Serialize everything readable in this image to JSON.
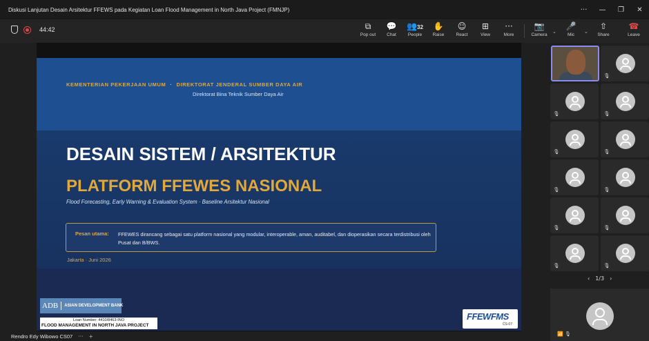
{
  "window": {
    "title": "Diskusi Lanjutan Desain Arsitektur FFEWS pada Kegiatan Loan Flood Management in North Java Project (FMNJP)",
    "controls": [
      "···",
      "—",
      "❐",
      "✕"
    ]
  },
  "toolbar": {
    "timer": "44:42",
    "buttons": {
      "popout": {
        "icon": "⧉",
        "label": "Pop out"
      },
      "chat": {
        "icon": "💬",
        "label": "Chat"
      },
      "people": {
        "icon": "👥",
        "label": "People",
        "count": "32"
      },
      "raise": {
        "icon": "✋",
        "label": "Raise"
      },
      "react": {
        "icon": "☺",
        "label": "React"
      },
      "view": {
        "icon": "⊞",
        "label": "View"
      },
      "more": {
        "icon": "···",
        "label": "More"
      },
      "camera": {
        "icon": "📷",
        "label": "Camera"
      },
      "mic": {
        "icon": "🎤",
        "label": "Mic"
      },
      "share": {
        "icon": "⇧",
        "label": "Share"
      },
      "leave": {
        "icon": "☎",
        "label": "Leave"
      }
    },
    "caret": "⌄",
    "colors": {
      "leave": "#e24a4a",
      "recording": "#e0454a"
    }
  },
  "slide": {
    "ministry_left": "KEMENTERIAN PEKERJAAN UMUM",
    "ministry_sep": "·",
    "ministry_right": "DIREKTORAT JENDERAL SUMBER DAYA AIR",
    "subdirectorate": "Direktorat Bina Teknik Sumber Daya Air",
    "title": "DESAIN SISTEM / ARSITEKTUR",
    "subtitle": "PLATFORM FFEWES NASIONAL",
    "tagline": "Flood Forecasting, Early Warning & Evaluation System  ·  Baseline Arsitektur Nasional",
    "message_label": "Pesan utama:",
    "message_text": "FFEWES dirancang sebagai satu platform nasional yang modular, interoperable, aman, auditabel, dan dioperasikan secara terdistribusi oleh Pusat dan B/BWS.",
    "place_date": "Jakarta · Juni 2026",
    "adb_mark": "ADB",
    "adb_name": "ASIAN DEVELOPMENT BANK",
    "loan_number": "Loan Number: 4410/8463-INO",
    "project": "FLOOD MANAGEMENT IN NORTH JAVA PROJECT",
    "logo_text": "FFEWFMS",
    "logo_sub": "CS-07",
    "colors": {
      "gold": "#e2a93a",
      "blue": "#1d4f91",
      "navy": "#1a2a52"
    }
  },
  "presenter": {
    "name": "Rendro Edy Wibowo CS07",
    "controls": [
      "···",
      "+"
    ]
  },
  "gallery": {
    "page": "1/3",
    "prev": "‹",
    "next": "›",
    "mute_icon": "🎙",
    "signal_icon": "📶",
    "accent": "#8b8cf0"
  }
}
